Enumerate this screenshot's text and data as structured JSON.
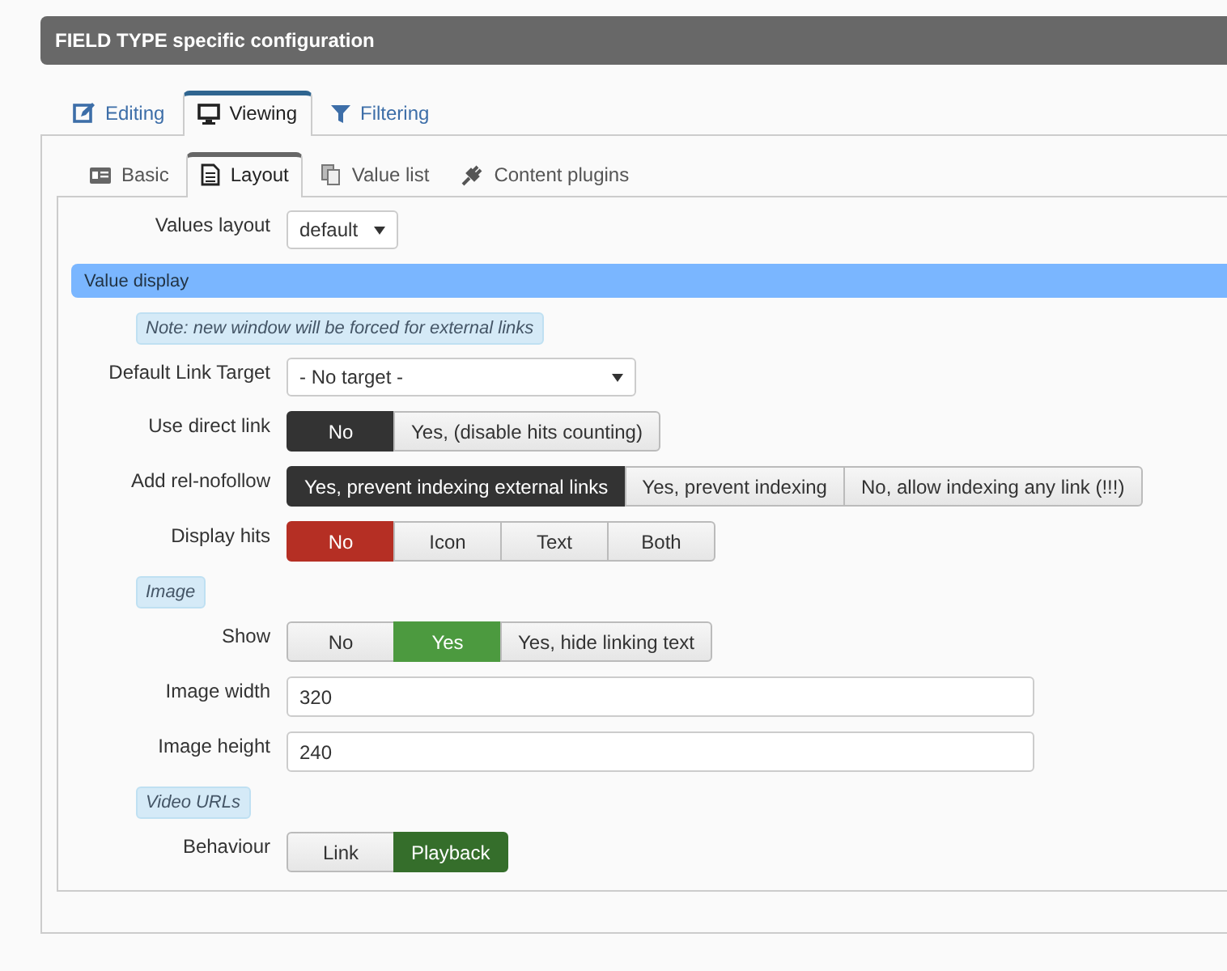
{
  "header": {
    "title": "FIELD TYPE specific configuration"
  },
  "tabs": [
    {
      "label": "Editing",
      "selected": false
    },
    {
      "label": "Viewing",
      "selected": true
    },
    {
      "label": "Filtering",
      "selected": false
    }
  ],
  "subtabs": [
    {
      "label": "Basic",
      "selected": false
    },
    {
      "label": "Layout",
      "selected": true
    },
    {
      "label": "Value list",
      "selected": false
    },
    {
      "label": "Content plugins",
      "selected": false
    }
  ],
  "rows": [
    {
      "kind": "dropdown",
      "label": "Values layout",
      "value": "default"
    },
    {
      "kind": "section",
      "label": "Value display"
    },
    {
      "kind": "note",
      "label": "Note: new window will be forced for external links"
    },
    {
      "kind": "select",
      "label": "Default Link Target",
      "value": "- No target -"
    },
    {
      "kind": "toggle",
      "label": "Use direct link",
      "color": "#333333",
      "options": [
        {
          "label": "No",
          "selected": true
        },
        {
          "label": "Yes, (disable hits counting)",
          "selected": false
        }
      ]
    },
    {
      "kind": "toggle",
      "label": "Add rel-nofollow",
      "color": "#333333",
      "options": [
        {
          "label": "Yes, prevent indexing external links",
          "selected": true
        },
        {
          "label": "Yes, prevent indexing",
          "selected": false
        },
        {
          "label": "No, allow indexing any link (!!!)",
          "selected": false
        }
      ]
    },
    {
      "kind": "toggle",
      "label": "Display hits",
      "color": "#b52f24",
      "options": [
        {
          "label": "No",
          "selected": true
        },
        {
          "label": "Icon",
          "selected": false
        },
        {
          "label": "Text",
          "selected": false
        },
        {
          "label": "Both",
          "selected": false
        }
      ]
    },
    {
      "kind": "note",
      "label": "Image"
    },
    {
      "kind": "toggle",
      "label": "Show",
      "color": "#4c9a3f",
      "options": [
        {
          "label": "No",
          "selected": false
        },
        {
          "label": "Yes",
          "selected": true
        },
        {
          "label": "Yes, hide linking text",
          "selected": false
        }
      ]
    },
    {
      "kind": "text",
      "label": "Image width",
      "value": "320"
    },
    {
      "kind": "text",
      "label": "Image height",
      "value": "240"
    },
    {
      "kind": "note",
      "label": "Video URLs"
    },
    {
      "kind": "toggle",
      "label": "Behaviour",
      "color": "#356e2b",
      "options": [
        {
          "label": "Link",
          "selected": false
        },
        {
          "label": "Playback",
          "selected": true
        }
      ]
    }
  ]
}
